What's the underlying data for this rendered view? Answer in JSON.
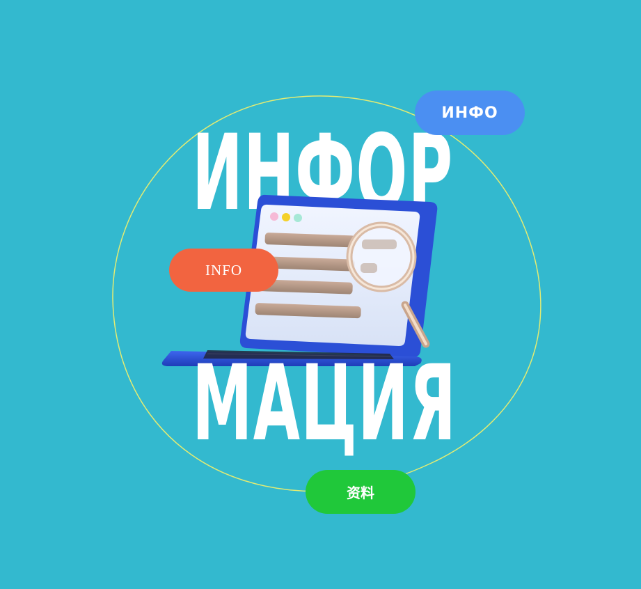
{
  "headline": {
    "line1": "ИНФОР",
    "line2": "МАЦИЯ"
  },
  "tags": {
    "russian": "ИНФО",
    "english": "INFO",
    "chinese": "资料"
  },
  "illustration": {
    "icons": [
      "laptop-icon",
      "magnifier-icon"
    ]
  },
  "colors": {
    "background": "#33b9cf",
    "tag_russian": "#4b8ff2",
    "tag_english": "#f26440",
    "tag_chinese": "#20c83a",
    "outline_curve": "#e4ec72",
    "laptop_blue": "#2b4fd6",
    "text": "#ffffff"
  }
}
